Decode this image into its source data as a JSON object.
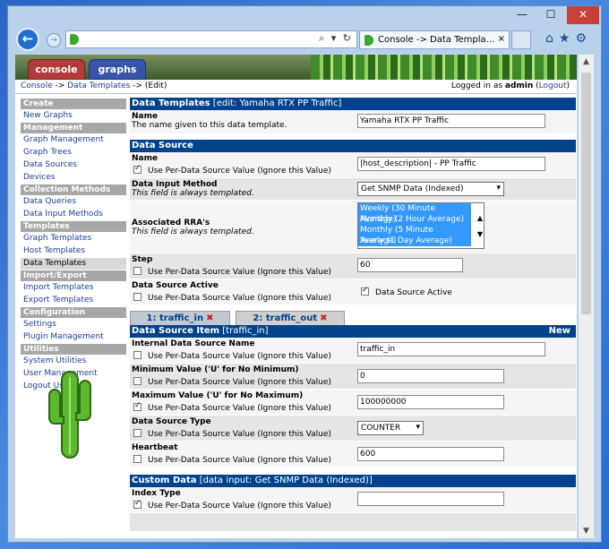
{
  "browser": {
    "tab_title": "Console -> Data Templa...",
    "tab_close": "×",
    "address_tools": "⌕ ▾ ↻"
  },
  "window": {
    "min": "—",
    "max": "☐",
    "close": "✕"
  },
  "header": {
    "tab_console": "console",
    "tab_graphs": "graphs"
  },
  "breadcrumb": {
    "console": "Console",
    "sep1": " -> ",
    "data_templates": "Data Templates",
    "sep2": " -> ",
    "edit": "(Edit)"
  },
  "login": {
    "prefix": "Logged in as ",
    "user": "admin",
    "open": " (",
    "logout": "Logout",
    "close": ")"
  },
  "menu": {
    "create": "Create",
    "new_graphs": "New Graphs",
    "management": "Management",
    "graph_management": "Graph Management",
    "graph_trees": "Graph Trees",
    "data_sources": "Data Sources",
    "devices": "Devices",
    "collection_methods": "Collection Methods",
    "data_queries": "Data Queries",
    "data_input_methods": "Data Input Methods",
    "templates": "Templates",
    "graph_templates": "Graph Templates",
    "host_templates": "Host Templates",
    "data_templates": "Data Templates",
    "import_export": "Import/Export",
    "import_templates": "Import Templates",
    "export_templates": "Export Templates",
    "configuration": "Configuration",
    "settings": "Settings",
    "plugin_management": "Plugin Management",
    "utilities": "Utilities",
    "system_utilities": "System Utilities",
    "user_management": "User Management",
    "logout_user": "Logout User"
  },
  "data_templates": {
    "heading": "Data Templates",
    "heading_edit": "[edit: Yamaha RTX PP Traffic]",
    "name_title": "Name",
    "name_desc": "The name given to this data template.",
    "name_value": "Yamaha RTX PP Traffic"
  },
  "data_source": {
    "heading": "Data Source",
    "name_title": "Name",
    "per_source_label": "Use Per-Data Source Value (Ignore this Value)",
    "name_value": "|host_description| - PP Traffic",
    "input_method_title": "Data Input Method",
    "always_templated": "This field is always templated.",
    "input_method_value": "Get SNMP Data (Indexed)",
    "rra_title": "Associated RRA's",
    "rra_options": [
      "Weekly (30 Minute Average)",
      "Monthly (2 Hour Average)",
      "Monthly (5 Minute Average)",
      "Yearly (1 Day Average)"
    ],
    "step_title": "Step",
    "step_value": "60",
    "active_title": "Data Source Active",
    "active_label": "Data Source Active"
  },
  "item_tabs": [
    {
      "label": "1: traffic_in",
      "x": "✖"
    },
    {
      "label": "2: traffic_out",
      "x": "✖"
    }
  ],
  "data_source_item": {
    "heading": "Data Source Item",
    "heading_item": "[traffic_in]",
    "new": "New",
    "internal_name_title": "Internal Data Source Name",
    "internal_name_value": "traffic_in",
    "min_title": "Minimum Value ('U' for No Minimum)",
    "min_value": "0",
    "max_title": "Maximum Value ('U' for No Maximum)",
    "max_value": "100000000",
    "type_title": "Data Source Type",
    "type_value": "COUNTER",
    "heartbeat_title": "Heartbeat",
    "heartbeat_value": "600"
  },
  "custom_data": {
    "heading": "Custom Data",
    "heading_input": "[data input: Get SNMP Data (Indexed)]",
    "index_type_title": "Index Type",
    "index_type_value": ""
  },
  "colors": {
    "section_header": "#00438c",
    "link": "#1a3f9a",
    "menu_section": "#a7a7a7"
  }
}
